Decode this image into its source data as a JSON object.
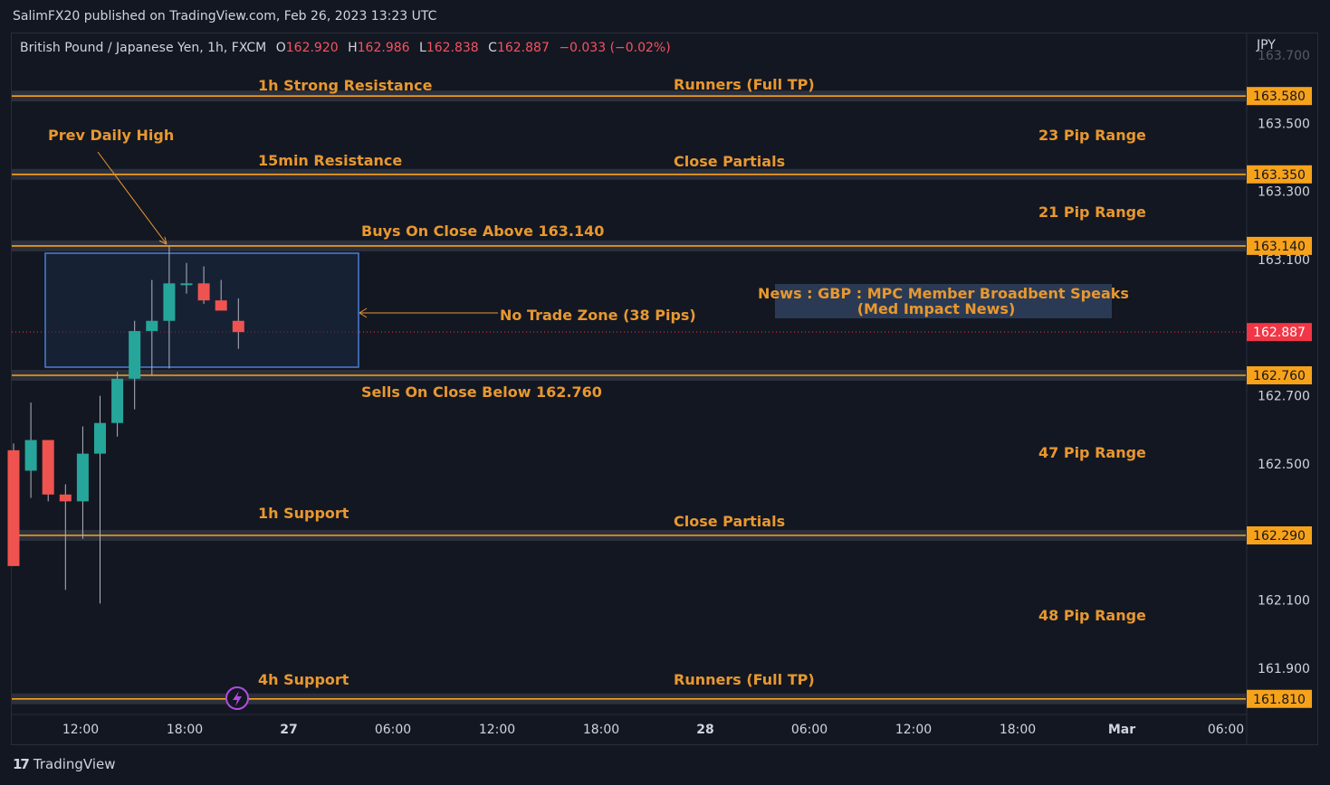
{
  "header": {
    "published_line": "SalimFX20 published on TradingView.com, Feb 26, 2023 13:23 UTC"
  },
  "symbol": {
    "name": "British Pound / Japanese Yen, 1h, FXCM",
    "open_label": "O",
    "open": "162.920",
    "high_label": "H",
    "high": "162.986",
    "low_label": "L",
    "low": "162.838",
    "close_label": "C",
    "close": "162.887",
    "change": "−0.033 (−0.02%)"
  },
  "axis": {
    "currency": "JPY",
    "y_ticks": [
      "163.700",
      "163.500",
      "163.300",
      "163.100",
      "162.700",
      "162.500",
      "162.100",
      "161.900"
    ],
    "x_ticks": [
      "12:00",
      "18:00",
      "27",
      "06:00",
      "12:00",
      "18:00",
      "28",
      "06:00",
      "12:00",
      "18:00",
      "Mar",
      "06:00"
    ],
    "last_price": "162.887"
  },
  "footer": {
    "logo_mark": "17",
    "logo_text": "TradingView"
  },
  "colors": {
    "background": "#131722",
    "level_line": "#f7a21b",
    "level_band": "#363a45",
    "annotation": "#e8982f",
    "up_candle": "#26a69a",
    "down_candle": "#ef5350",
    "zone_border": "#4a7fd4",
    "zone_fill": "#1c2a44",
    "news_box": "#2a3a55",
    "last_price_tag": "#f23645",
    "news_icon": "#b04de0"
  },
  "chart_data": {
    "type": "candlestick",
    "title": "British Pound / Japanese Yen, 1h, FXCM",
    "ylim": [
      161.75,
      163.75
    ],
    "candles": [
      {
        "o": 162.54,
        "h": 162.56,
        "l": 162.2,
        "c": 162.2
      },
      {
        "o": 162.48,
        "h": 162.68,
        "l": 162.4,
        "c": 162.57
      },
      {
        "o": 162.57,
        "h": 162.47,
        "l": 162.39,
        "c": 162.41
      },
      {
        "o": 162.41,
        "h": 162.44,
        "l": 162.13,
        "c": 162.39
      },
      {
        "o": 162.39,
        "h": 162.61,
        "l": 162.28,
        "c": 162.53
      },
      {
        "o": 162.53,
        "h": 162.7,
        "l": 162.09,
        "c": 162.62
      },
      {
        "o": 162.62,
        "h": 162.77,
        "l": 162.58,
        "c": 162.75
      },
      {
        "o": 162.75,
        "h": 162.92,
        "l": 162.66,
        "c": 162.89
      },
      {
        "o": 162.89,
        "h": 163.04,
        "l": 162.76,
        "c": 162.92
      },
      {
        "o": 162.92,
        "h": 163.14,
        "l": 162.78,
        "c": 163.03
      },
      {
        "o": 163.03,
        "h": 163.09,
        "l": 163.0,
        "c": 163.03
      },
      {
        "o": 163.03,
        "h": 163.08,
        "l": 162.97,
        "c": 162.98
      },
      {
        "o": 162.98,
        "h": 163.04,
        "l": 162.95,
        "c": 162.95
      },
      {
        "o": 162.92,
        "h": 162.986,
        "l": 162.838,
        "c": 162.887
      }
    ],
    "levels": [
      {
        "price": 163.58,
        "label": "163.580"
      },
      {
        "price": 163.35,
        "label": "163.350"
      },
      {
        "price": 163.14,
        "label": "163.140"
      },
      {
        "price": 162.76,
        "label": "162.760"
      },
      {
        "price": 162.29,
        "label": "162.290"
      },
      {
        "price": 161.81,
        "label": "161.810"
      }
    ],
    "annotations": [
      {
        "text": "1h Strong Resistance"
      },
      {
        "text": "Runners (Full TP)"
      },
      {
        "text": "Prev Daily High"
      },
      {
        "text": "23 Pip Range"
      },
      {
        "text": "15min Resistance"
      },
      {
        "text": "Close Partials"
      },
      {
        "text": "21 Pip Range"
      },
      {
        "text": "Buys On Close Above  163.140"
      },
      {
        "text": "No Trade Zone (38 Pips)"
      },
      {
        "text": "Sells On Close Below 162.760"
      },
      {
        "text": "47 Pip Range"
      },
      {
        "text": "1h Support"
      },
      {
        "text": "Close Partials"
      },
      {
        "text": "48 Pip Range"
      },
      {
        "text": "4h Support"
      },
      {
        "text": "Runners (Full TP)"
      }
    ],
    "news": {
      "line1": "News : GBP : MPC Member Broadbent Speaks",
      "line2": "(Med Impact News)"
    },
    "no_trade_zone": {
      "top": 163.12,
      "bottom": 162.78
    }
  }
}
